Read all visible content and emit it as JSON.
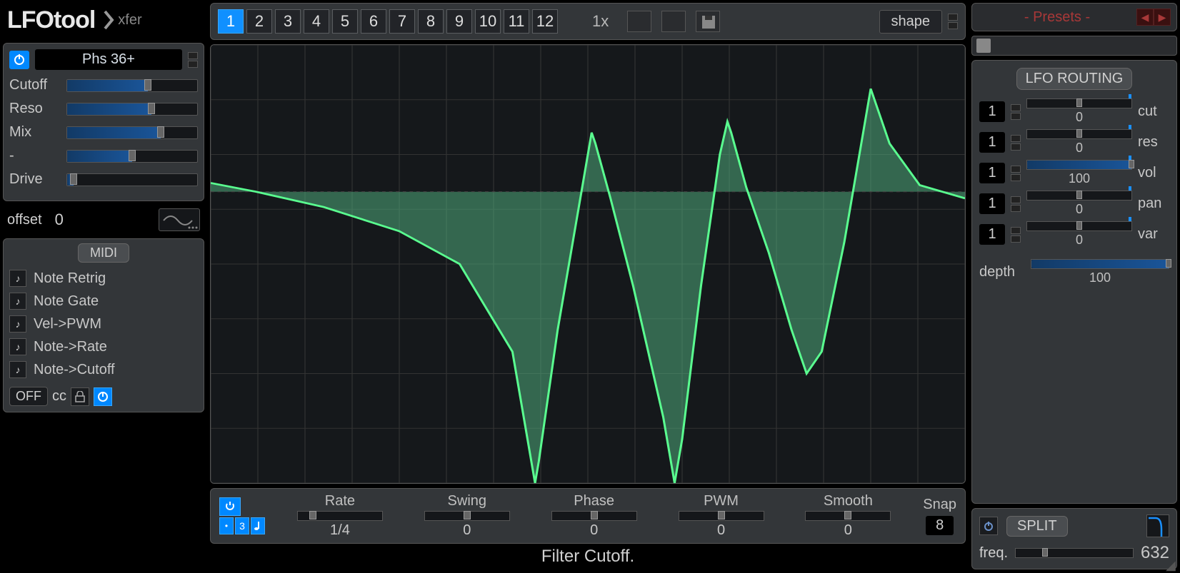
{
  "app": {
    "name": "LFOtool",
    "brand": "xfer"
  },
  "filter": {
    "type": "Phs 36+",
    "params": [
      {
        "label": "Cutoff",
        "pos": 62
      },
      {
        "label": "Reso",
        "pos": 65
      },
      {
        "label": "Mix",
        "pos": 72
      },
      {
        "label": "-",
        "pos": 50
      },
      {
        "label": "Drive",
        "pos": 5
      }
    ],
    "offset_label": "offset",
    "offset_value": "0"
  },
  "midi": {
    "header": "MIDI",
    "items": [
      "Note Retrig",
      "Note Gate",
      "Vel->PWM",
      "Note->Rate",
      "Note->Cutoff"
    ],
    "off": "OFF",
    "cc": "cc"
  },
  "slots": {
    "labels": [
      "1",
      "2",
      "3",
      "4",
      "5",
      "6",
      "7",
      "8",
      "9",
      "10",
      "11",
      "12"
    ],
    "active": 0,
    "mult": "1x",
    "shape": "shape"
  },
  "bottom": {
    "params": [
      {
        "label": "Rate",
        "value": "1/4",
        "pos": 18
      },
      {
        "label": "Swing",
        "value": "0",
        "pos": 50
      },
      {
        "label": "Phase",
        "value": "0",
        "pos": 50
      },
      {
        "label": "PWM",
        "value": "0",
        "pos": 50
      },
      {
        "label": "Smooth",
        "value": "0",
        "pos": 50
      }
    ],
    "snap_label": "Snap",
    "snap_value": "8"
  },
  "status": "Filter Cutoff.",
  "presets": {
    "text": "- Presets -"
  },
  "routing": {
    "header": "LFO ROUTING",
    "rows": [
      {
        "label": "cut",
        "src": "1",
        "value": "0",
        "pos": 50,
        "fill": 0
      },
      {
        "label": "res",
        "src": "1",
        "value": "0",
        "pos": 50,
        "fill": 0
      },
      {
        "label": "vol",
        "src": "1",
        "value": "100",
        "pos": 100,
        "fill": 100
      },
      {
        "label": "pan",
        "src": "1",
        "value": "0",
        "pos": 50,
        "fill": 0
      },
      {
        "label": "var",
        "src": "1",
        "value": "0",
        "pos": 50,
        "fill": 0
      }
    ],
    "depth_label": "depth",
    "depth_value": "100",
    "depth_pos": 100
  },
  "split": {
    "header": "SPLIT",
    "freq_label": "freq.",
    "freq_value": "632",
    "freq_pos": 25
  },
  "chart_data": {
    "type": "line",
    "title": "LFO Curve",
    "x_range": [
      0,
      1
    ],
    "y_range": [
      -1,
      1
    ],
    "baseline": 0.33,
    "curve": [
      [
        0.0,
        0.37
      ],
      [
        0.06,
        0.33
      ],
      [
        0.15,
        0.26
      ],
      [
        0.25,
        0.15
      ],
      [
        0.33,
        0.0
      ],
      [
        0.4,
        -0.4
      ],
      [
        0.425,
        -0.9
      ],
      [
        0.43,
        -1.0
      ],
      [
        0.435,
        -0.9
      ],
      [
        0.46,
        -0.3
      ],
      [
        0.49,
        0.3
      ],
      [
        0.505,
        0.6
      ],
      [
        0.51,
        0.55
      ],
      [
        0.53,
        0.3
      ],
      [
        0.56,
        -0.1
      ],
      [
        0.6,
        -0.7
      ],
      [
        0.615,
        -1.0
      ],
      [
        0.625,
        -0.8
      ],
      [
        0.65,
        -0.1
      ],
      [
        0.675,
        0.5
      ],
      [
        0.685,
        0.65
      ],
      [
        0.69,
        0.6
      ],
      [
        0.71,
        0.35
      ],
      [
        0.74,
        0.05
      ],
      [
        0.77,
        -0.3
      ],
      [
        0.79,
        -0.5
      ],
      [
        0.81,
        -0.4
      ],
      [
        0.84,
        0.1
      ],
      [
        0.865,
        0.6
      ],
      [
        0.875,
        0.8
      ],
      [
        0.88,
        0.75
      ],
      [
        0.9,
        0.55
      ],
      [
        0.94,
        0.36
      ],
      [
        1.0,
        0.3
      ]
    ]
  }
}
